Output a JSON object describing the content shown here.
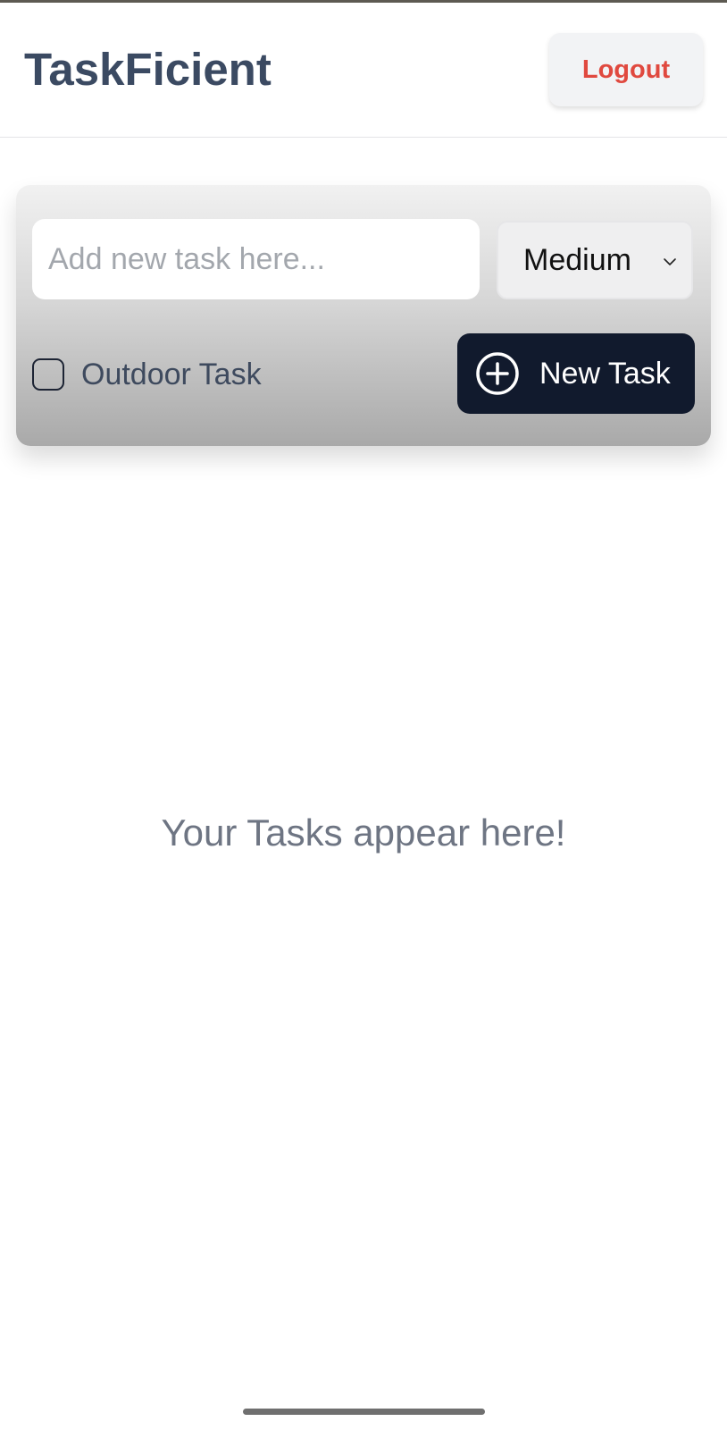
{
  "header": {
    "app_title": "TaskFicient",
    "logout_label": "Logout"
  },
  "task_form": {
    "input_placeholder": "Add new task here...",
    "input_value": "",
    "priority_selected": "Medium",
    "outdoor_label": "Outdoor Task",
    "outdoor_checked": false,
    "new_task_label": "New Task",
    "new_task_icon": "plus-circle-icon",
    "select_icon": "chevron-down-icon"
  },
  "main": {
    "empty_message": "Your Tasks appear here!"
  },
  "colors": {
    "title": "#3b4a62",
    "logout_text": "#e0493f",
    "primary_button": "#111a2d",
    "empty_text": "#6e7583"
  }
}
